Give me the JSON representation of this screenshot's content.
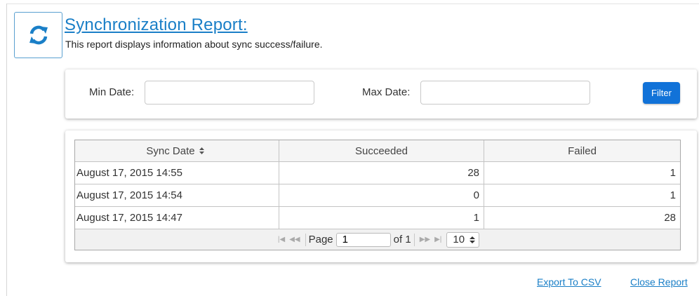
{
  "header": {
    "title": "Synchronization Report:",
    "subtitle": "This report displays information about sync success/failure.",
    "icon": "sync-icon"
  },
  "filters": {
    "min_label": "Min Date:",
    "min_value": "",
    "max_label": "Max Date:",
    "max_value": "",
    "button_label": "Filter",
    "button_color": "#1172d8"
  },
  "table": {
    "columns": [
      "Sync Date",
      "Succeeded",
      "Failed"
    ],
    "rows": [
      {
        "date": "August 17, 2015 14:55",
        "succeeded": "28",
        "failed": "1"
      },
      {
        "date": "August 17, 2015 14:54",
        "succeeded": "0",
        "failed": "1"
      },
      {
        "date": "August 17, 2015 14:47",
        "succeeded": "1",
        "failed": "28"
      }
    ]
  },
  "pager": {
    "page_label": "Page",
    "page_value": "1",
    "of_label": "of 1",
    "page_size": "10"
  },
  "footer": {
    "export_label": "Export To CSV",
    "close_label": "Close Report"
  },
  "colors": {
    "link": "#1a7fc7",
    "icon": "#1a7fc7"
  }
}
